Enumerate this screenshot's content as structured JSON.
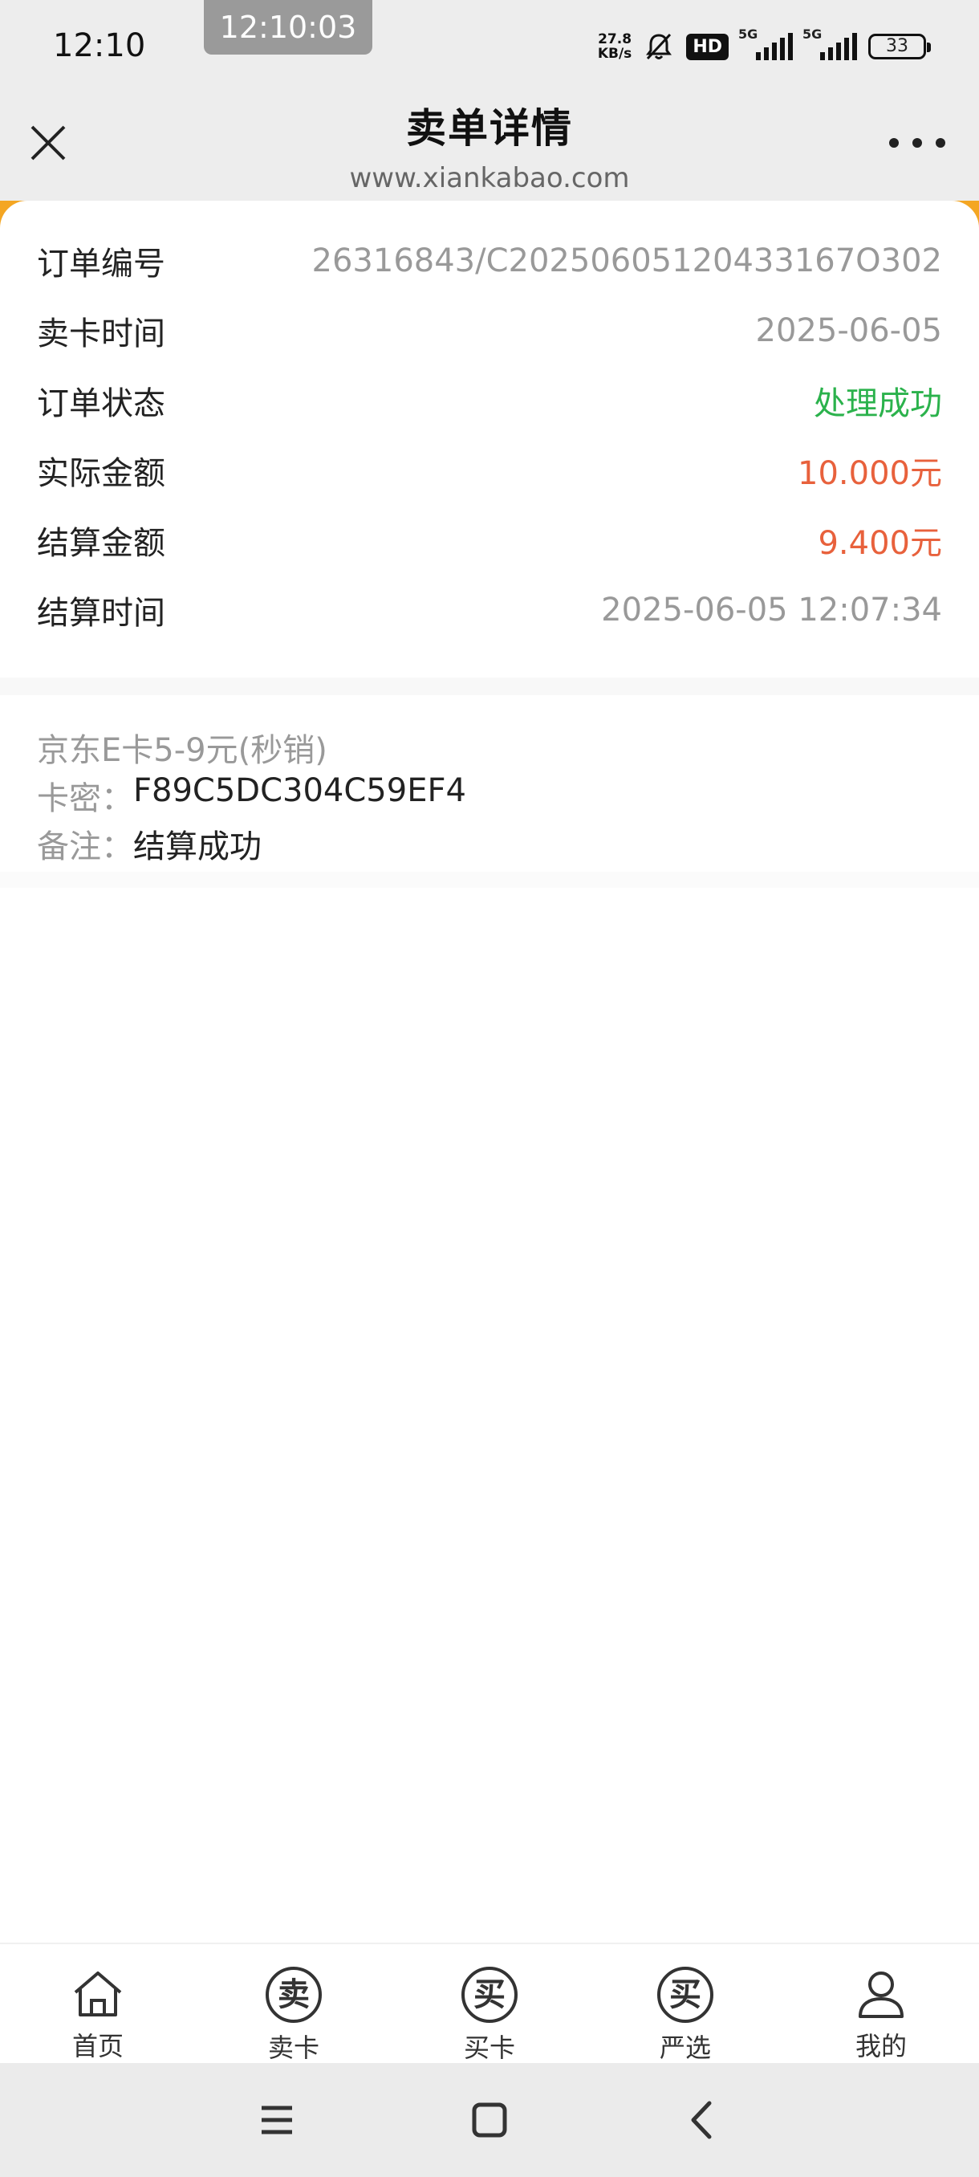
{
  "status_bar": {
    "time": "12:10",
    "clock_badge": "12:10:03",
    "net_speed_top": "27.8",
    "net_speed_unit": "KB/s",
    "hd_label": "HD",
    "signal1_label": "5G",
    "signal2_label": "5G",
    "battery": "33"
  },
  "header": {
    "title": "卖单详情",
    "url": "www.xiankabao.com"
  },
  "order": {
    "rows": [
      {
        "label": "订单编号",
        "value": "26316843/C20250605120433167O302"
      },
      {
        "label": "卖卡时间",
        "value": "2025-06-05"
      },
      {
        "label": "订单状态",
        "value": "处理成功"
      },
      {
        "label": "实际金额",
        "value": "10.000元"
      },
      {
        "label": "结算金额",
        "value": "9.400元"
      },
      {
        "label": "结算时间",
        "value": "2025-06-05 12:07:34"
      }
    ]
  },
  "card": {
    "name": "京东E卡5-9元(秒销)",
    "secret_key": "卡密：",
    "secret_value": "F89C5DC304C59EF4",
    "note_key": "备注：",
    "note_value": "结算成功"
  },
  "tabs": {
    "home": "首页",
    "sell": "卖卡",
    "buy": "买卡",
    "select": "严选",
    "mine": "我的",
    "sell_glyph": "卖",
    "buy_glyph": "买",
    "select_glyph": "买"
  },
  "colors": {
    "accent": "#f4a623",
    "success": "#2bb24c",
    "amount": "#e8613c"
  }
}
